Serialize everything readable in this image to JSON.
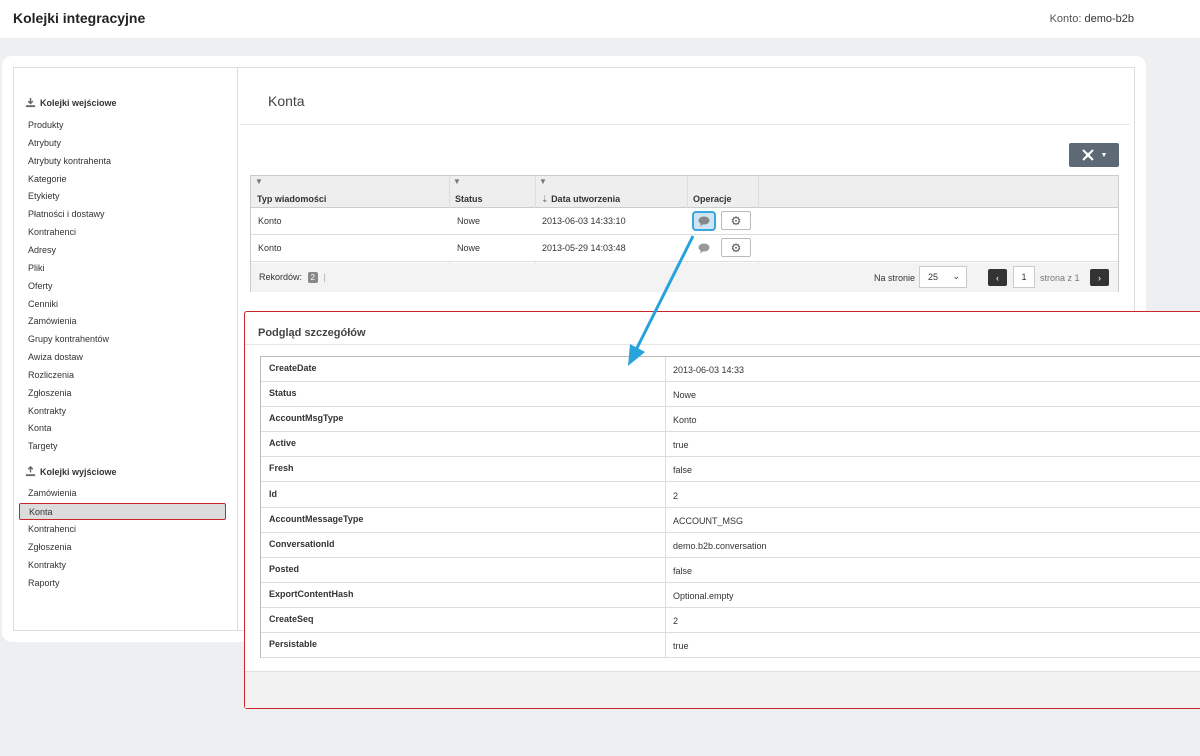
{
  "header": {
    "title": "Kolejki integracyjne",
    "account_label": "Konto:",
    "account_value": "demo-b2b"
  },
  "sidebar": {
    "incoming_title": "Kolejki wejściowe",
    "incoming_items": [
      "Produkty",
      "Atrybuty",
      "Atrybuty kontrahenta",
      "Kategorie",
      "Etykiety",
      "Płatności i dostawy",
      "Kontrahenci",
      "Adresy",
      "Pliki",
      "Oferty",
      "Cenniki",
      "Zamówienia",
      "Grupy kontrahentów",
      "Awiza dostaw",
      "Rozliczenia",
      "Zgłoszenia",
      "Kontrakty",
      "Konta",
      "Targety"
    ],
    "outgoing_title": "Kolejki wyjściowe",
    "outgoing_items": [
      "Zamówienia",
      "Konta",
      "Kontrahenci",
      "Zgłoszenia",
      "Kontrakty",
      "Raporty"
    ],
    "active_item": "Konta"
  },
  "main": {
    "title": "Konta",
    "toolbar_icon": "tools-icon",
    "grid": {
      "columns": [
        "Typ wiadomości",
        "Status",
        "Data utworzenia",
        "Operacje"
      ],
      "sort_indicator": "⇣",
      "rows": [
        {
          "type": "Konto",
          "status": "Nowe",
          "date": "2013-06-03 14:33:10"
        },
        {
          "type": "Konto",
          "status": "Nowe",
          "date": "2013-05-29 14:03:48"
        }
      ],
      "records_label": "Rekordów:",
      "records_count": "2",
      "per_page_label": "Na stronie",
      "per_page_value": "25",
      "page_value": "1",
      "page_of": "strona z 1"
    }
  },
  "detail": {
    "title": "Podgląd szczegółów",
    "rows": [
      {
        "key": "CreateDate",
        "value": "2013-06-03 14:33"
      },
      {
        "key": "Status",
        "value": "Nowe"
      },
      {
        "key": "AccountMsgType",
        "value": "Konto"
      },
      {
        "key": "Active",
        "value": "true"
      },
      {
        "key": "Fresh",
        "value": "false"
      },
      {
        "key": "Id",
        "value": "2"
      },
      {
        "key": "AccountMessageType",
        "value": "ACCOUNT_MSG"
      },
      {
        "key": "ConversationId",
        "value": "demo.b2b.conversation"
      },
      {
        "key": "Posted",
        "value": "false"
      },
      {
        "key": "ExportContentHash",
        "value": "Optional.empty"
      },
      {
        "key": "CreateSeq",
        "value": "2"
      },
      {
        "key": "Persistable",
        "value": "true"
      }
    ]
  },
  "colors": {
    "highlight_border": "#c8262c",
    "arrow": "#29a3dc",
    "tool_button": "#5d6a75"
  }
}
